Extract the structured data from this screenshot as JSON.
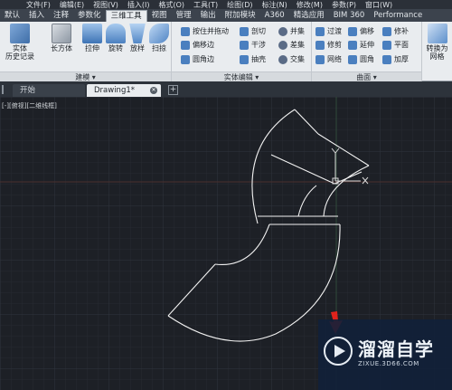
{
  "menubar": {
    "items": [
      "文件(F)",
      "编辑(E)",
      "视图(V)",
      "插入(I)",
      "格式(O)",
      "工具(T)",
      "绘图(D)",
      "标注(N)",
      "修改(M)",
      "参数(P)",
      "窗口(W)"
    ]
  },
  "ribbon_tabs": [
    "默认",
    "插入",
    "注释",
    "参数化",
    "三维工具",
    "视图",
    "管理",
    "输出",
    "附加模块",
    "A360",
    "精选应用",
    "BIM 360",
    "Performance"
  ],
  "active_tab": "三维工具",
  "panels": {
    "modeling": {
      "title": "建模 ▾",
      "history_label": "实体\n历史记录",
      "box_label": "长方体",
      "extrude_label": "拉伸",
      "revolve_label": "旋转",
      "loft_label": "放样",
      "sweep_label": "扫掠"
    },
    "solid_edit": {
      "title": "实体编辑 ▾",
      "buttons": [
        "按住并拖动",
        "偏移边",
        "圆角边",
        "剖切",
        "干涉",
        "抽壳",
        "并集",
        "差集",
        "交集"
      ]
    },
    "surface": {
      "title": "曲面 ▾",
      "buttons": [
        "过渡",
        "偏移",
        "修剪",
        "修补",
        "延伸",
        "平面",
        "网络",
        "圆角",
        "加厚"
      ]
    },
    "convert": {
      "label": "转换为\n网格"
    }
  },
  "doc_tabs": {
    "start": "开始",
    "drawing": "Drawing1*"
  },
  "viewport_label": "[-][俯视][二维线框]",
  "watermark": {
    "title": "溜溜自学",
    "subtitle": "ZIXUE.3D66.COM"
  },
  "colors": {
    "canvas_bg": "#1d2026",
    "ribbon_bg": "#e9ecef",
    "accent_arrow": "#e0231c"
  }
}
